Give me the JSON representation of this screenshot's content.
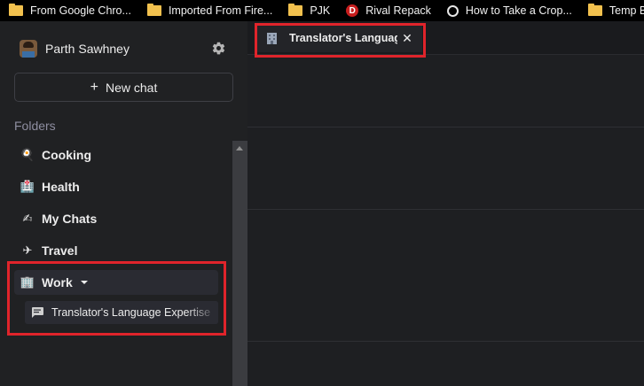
{
  "bookmarks": [
    {
      "label": "From Google Chro...",
      "icon": "folder-icon"
    },
    {
      "label": "Imported From Fire...",
      "icon": "folder-icon"
    },
    {
      "label": "PJK",
      "icon": "folder-icon"
    },
    {
      "label": "Rival Repack",
      "icon": "rival-repack-icon",
      "icon_glyph": "D"
    },
    {
      "label": "How to Take a Crop...",
      "icon": "globe-icon"
    },
    {
      "label": "Temp Bookmark",
      "icon": "folder-icon"
    }
  ],
  "sidebar": {
    "profile": {
      "name": "Parth Sawhney",
      "avatar": "avatar-image",
      "settings_icon": "gear-icon"
    },
    "new_chat": {
      "icon": "plus-icon",
      "icon_glyph": "+",
      "label": "New chat"
    },
    "folders_label": "Folders",
    "folders": [
      {
        "label": "Cooking",
        "icon": "cooking-emoji-icon",
        "glyph": "🍳"
      },
      {
        "label": "Health",
        "icon": "health-emoji-icon",
        "glyph": "🏥"
      },
      {
        "label": "My Chats",
        "icon": "writing-hand-emoji-icon",
        "glyph": "✍"
      },
      {
        "label": "Travel",
        "icon": "airplane-emoji-icon",
        "glyph": "✈"
      },
      {
        "label": "Work",
        "icon": "office-building-emoji-icon",
        "glyph": "🏢",
        "expanded": true
      }
    ],
    "work_chats": [
      {
        "label": "Translator's Language Expertise",
        "icon": "chat-bubble-icon"
      }
    ]
  },
  "tabs": [
    {
      "title": "Translator's Language Expertise",
      "icon": "office-building-icon",
      "close_glyph": "✕"
    }
  ],
  "colors": {
    "highlight": "#e0242b",
    "sidebar_bg": "#202123",
    "main_bg": "#1e1f22",
    "bookmark_bar": "#000000"
  }
}
